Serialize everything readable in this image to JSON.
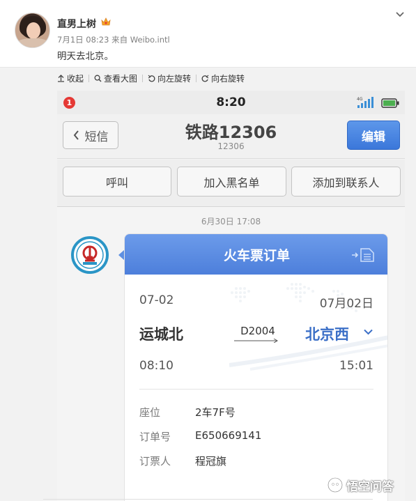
{
  "post": {
    "username": "直男上树",
    "meta": "7月1日 08:23 来自 Weibo.intl",
    "text": "明天去北京。"
  },
  "toolbar": {
    "items": [
      {
        "label": "收起",
        "icon": "collapse-icon"
      },
      {
        "label": "查看大图",
        "icon": "magnifier-icon"
      },
      {
        "label": "向左旋转",
        "icon": "rotate-left-icon"
      },
      {
        "label": "向右旋转",
        "icon": "rotate-right-icon"
      }
    ]
  },
  "phone": {
    "status": {
      "badge": "1",
      "time": "8:20",
      "network": "4G"
    },
    "nav": {
      "back_label": "短信",
      "title": "铁路12306",
      "subtitle": "12306",
      "edit_label": "编辑"
    },
    "actions": [
      "呼叫",
      "加入黑名单",
      "添加到联系人"
    ],
    "chat": {
      "timestamp": "6月30日 17:08",
      "ticket": {
        "title": "火车票订单",
        "depart_date": "07-02",
        "arrive_date": "07月02日",
        "from": "运城北",
        "train": "D2004",
        "to": "北京西",
        "depart_time": "08:10",
        "arrive_time": "15:01",
        "rows": [
          {
            "label": "座位",
            "value": "2车7F号"
          },
          {
            "label": "订单号",
            "value": "E650669141"
          },
          {
            "label": "订票人",
            "value": "程冠旗"
          }
        ]
      }
    }
  },
  "watermark": {
    "text": "悟空问答"
  },
  "colors": {
    "accent": "#4d7fdb",
    "badge": "#e53935",
    "destination": "#3b6fc7",
    "logo_ring": "#2a95c6",
    "battery": "#4caf50"
  }
}
